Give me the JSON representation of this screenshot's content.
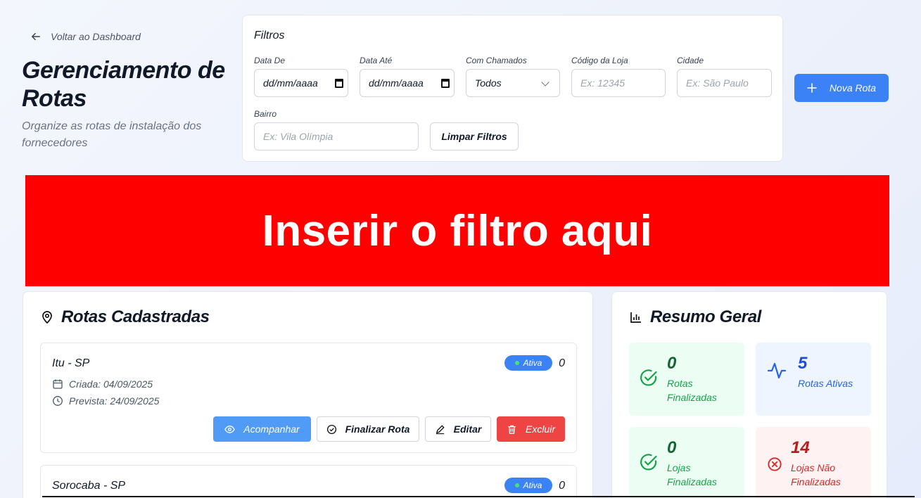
{
  "nav": {
    "back_label": "Voltar ao Dashboard"
  },
  "header": {
    "title": "Gerenciamento de Rotas",
    "subtitle": "Organize as rotas de instalação dos fornecedores"
  },
  "filters": {
    "title": "Filtros",
    "date_from": {
      "label": "Data De",
      "value": "dd/mm/aaaa"
    },
    "date_to": {
      "label": "Data Até",
      "value": "dd/mm/aaaa"
    },
    "tickets": {
      "label": "Com Chamados",
      "value": "Todos"
    },
    "store_code": {
      "label": "Código da Loja",
      "placeholder": "Ex: 12345"
    },
    "city": {
      "label": "Cidade",
      "placeholder": "Ex: São Paulo"
    },
    "neighborhood": {
      "label": "Bairro",
      "placeholder": "Ex: Vila Olímpia"
    },
    "clear_label": "Limpar Filtros"
  },
  "new_route_label": "Nova Rota",
  "banner_text": "Inserir o filtro aqui",
  "routes_panel": {
    "title": "Rotas Cadastradas",
    "routes": [
      {
        "name": "Itu - SP",
        "status": "Ativa",
        "count": "0",
        "created": "Criada: 04/09/2025",
        "expected": "Prevista: 24/09/2025"
      },
      {
        "name": "Sorocaba - SP",
        "status": "Ativa",
        "count": "0"
      }
    ],
    "actions": {
      "track": "Acompanhar",
      "finish": "Finalizar Rota",
      "edit": "Editar",
      "delete": "Excluir"
    }
  },
  "summary": {
    "title": "Resumo Geral",
    "stats": [
      {
        "value": "0",
        "label": "Rotas Finalizadas",
        "tone": "green"
      },
      {
        "value": "5",
        "label": "Rotas Ativas",
        "tone": "blue"
      },
      {
        "value": "0",
        "label": "Lojas Finalizadas",
        "tone": "green"
      },
      {
        "value": "14",
        "label": "Lojas Não Finalizadas",
        "tone": "red"
      }
    ]
  },
  "colors": {
    "primary": "#3b82f6",
    "danger": "#ef4444",
    "banner": "#ff0000",
    "success": "#16a34a"
  }
}
